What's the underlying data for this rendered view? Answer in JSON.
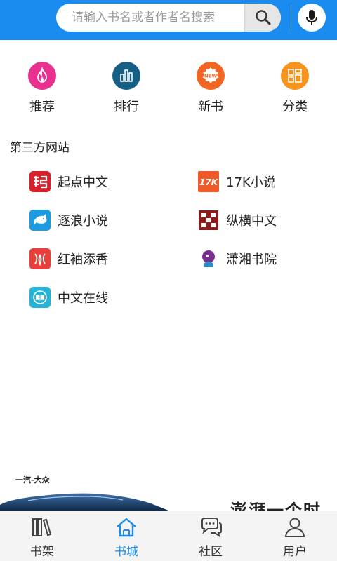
{
  "header": {
    "search_placeholder": "请输入书名或者作者名搜索",
    "search_icon": "search-icon",
    "mic_icon": "microphone-icon",
    "accent": "#1a8cf0"
  },
  "categories": [
    {
      "label": "推荐",
      "icon": "flame-icon",
      "color": "#e8308f"
    },
    {
      "label": "排行",
      "icon": "bar-chart-icon",
      "color": "#155f85"
    },
    {
      "label": "新书",
      "icon": "new-badge-icon",
      "color": "#f26522"
    },
    {
      "label": "分类",
      "icon": "grid-icon",
      "color": "#f7941d"
    }
  ],
  "third_party": {
    "title": "第三方网站",
    "sites": [
      {
        "label": "起点中文",
        "icon": "qidian-icon"
      },
      {
        "label": "17K小说",
        "icon": "17k-icon"
      },
      {
        "label": "逐浪小说",
        "icon": "dolphin-icon"
      },
      {
        "label": "纵横中文",
        "icon": "zongheng-icon"
      },
      {
        "label": "红袖添香",
        "icon": "hongxiu-icon"
      },
      {
        "label": "潇湘书院",
        "icon": "xiaoxiang-icon"
      },
      {
        "label": "中文在线",
        "icon": "book-icon"
      }
    ]
  },
  "banner": {
    "brand": "一汽-大众",
    "slogan": "澎湃一个时"
  },
  "tabs": [
    {
      "label": "书架",
      "icon": "bookshelf-icon",
      "active": false
    },
    {
      "label": "书城",
      "icon": "home-icon",
      "active": true
    },
    {
      "label": "社区",
      "icon": "chat-icon",
      "active": false
    },
    {
      "label": "用户",
      "icon": "user-icon",
      "active": false
    }
  ]
}
